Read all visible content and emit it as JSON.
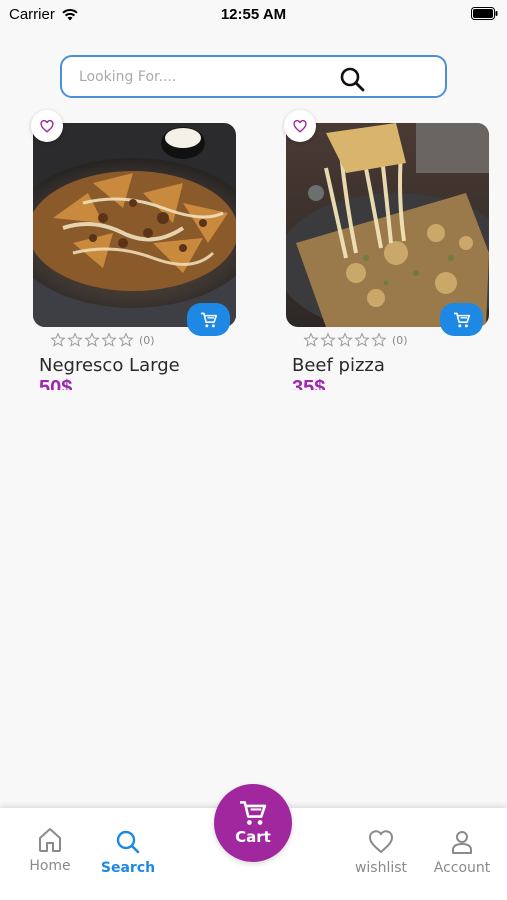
{
  "status_bar": {
    "carrier": "Carrier",
    "time": "12:55 AM"
  },
  "search": {
    "placeholder": "Looking For....",
    "value": ""
  },
  "products": [
    {
      "title": "Negresco Large",
      "price": "50$",
      "rating_count": "(0)",
      "rating": 0
    },
    {
      "title": "Beef pizza",
      "price": "35$",
      "rating_count": "(0)",
      "rating": 0
    }
  ],
  "bottom_nav": {
    "home": "Home",
    "search": "Search",
    "cart": "Cart",
    "wishlist": "wishlist",
    "account": "Account"
  },
  "colors": {
    "accent_blue": "#1e88e5",
    "brand_purple": "#a1279e",
    "price_purple": "#9c27b0",
    "search_border": "#4a90d9"
  },
  "icons": {
    "wifi": "wifi-icon",
    "battery": "battery-icon",
    "search": "search-icon",
    "favorite": "heart-icon",
    "add_to_cart": "cart-icon",
    "star": "star-outline-icon",
    "home": "home-icon",
    "account": "user-icon"
  }
}
